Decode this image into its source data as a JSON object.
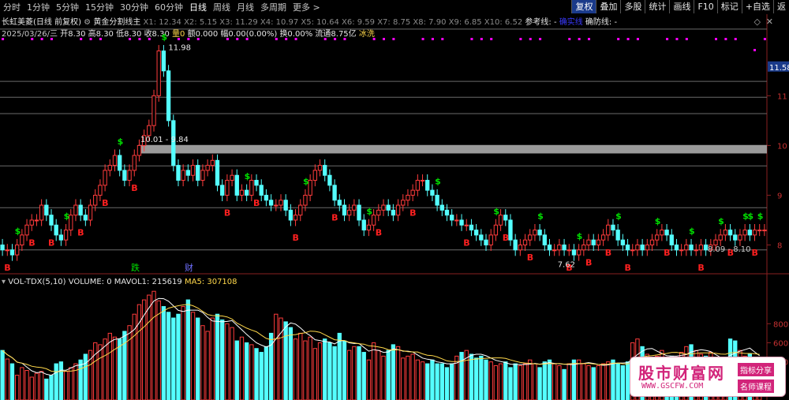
{
  "toolbar": {
    "periods": [
      "分时",
      "1分钟",
      "5分钟",
      "15分钟",
      "30分钟",
      "60分钟",
      "日线",
      "周线",
      "月线",
      "多周期",
      "更多 >"
    ],
    "active_period": "日线",
    "buttons": [
      "复权",
      "叠加",
      "多股",
      "统计",
      "画线",
      "F10",
      "标记",
      "+自选",
      "返"
    ]
  },
  "header": {
    "stock_name": "长虹美菱(日线 前复权)",
    "indicator_name": "黄金分割线主",
    "x_levels": "X1: 12.34  X2: 5.15  X3: 11.29  X4: 10.97  X5: 10.64  X6: 9.59  X7: 8.75  X8: 7.90  X9: 6.85  X10: 6.52",
    "ref_line_label": "参考线: -",
    "mid_label": "确实线",
    "defense_label": "确防线: -",
    "date": "2025/03/26/三",
    "open": "开8.30",
    "high": "高8.30",
    "low": "低8.30",
    "close": "收8.30",
    "volume": "量0",
    "amount": "额0.000",
    "change": "幅0.00(0.00%)",
    "turnover": "换0.00%",
    "float": "流通8.75亿",
    "status": "冰洗"
  },
  "price_axis": {
    "labels": [
      "11",
      "10",
      "9",
      "8"
    ],
    "highlight": "11.58"
  },
  "annotations": {
    "peak": "11.98",
    "gap": "10.01 - 9.84",
    "low": "7.62",
    "right_range": "8.09 - 8.10",
    "event1": "跌",
    "event2": "财"
  },
  "volume_panel": {
    "title": "VOL-TDX(5,10)",
    "volume": "VOLUME: 0",
    "mavol1": "MAVOL1: 215619",
    "ma5": "MA5: 307108",
    "axis_labels": [
      "800",
      "600",
      "400"
    ]
  },
  "watermark": {
    "main": "股市财富网",
    "url": "WWW.GSCFW.COM",
    "tag1": "指标分享",
    "tag2": "名师课程"
  },
  "colors": {
    "up": "#ff3c3c",
    "down": "#54ffff",
    "ma_white": "#ffffff",
    "ma_yellow": "#ffd84a",
    "signal_buy": "#ff2020",
    "signal_sell": "#00e000",
    "marker_magenta": "#ff00ff"
  },
  "chart_data": {
    "type": "candlestick",
    "ylim": [
      7.5,
      12.1
    ],
    "x": [
      1,
      2,
      3,
      4,
      5,
      6,
      7,
      8,
      9,
      10,
      11,
      12,
      13,
      14,
      15,
      16,
      17,
      18,
      19,
      20,
      21,
      22,
      23,
      24,
      25,
      26,
      27,
      28,
      29,
      30,
      31,
      32,
      33,
      34,
      35,
      36,
      37,
      38,
      39,
      40,
      41,
      42,
      43,
      44,
      45,
      46,
      47,
      48,
      49,
      50,
      51,
      52,
      53,
      54,
      55,
      56,
      57,
      58,
      59,
      60,
      61,
      62,
      63,
      64,
      65,
      66,
      67,
      68,
      69,
      70,
      71,
      72,
      73,
      74,
      75,
      76,
      77,
      78,
      79,
      80,
      81,
      82,
      83,
      84,
      85,
      86,
      87,
      88,
      89,
      90,
      91,
      92,
      93,
      94,
      95,
      96,
      97,
      98,
      99,
      100,
      101,
      102,
      103,
      104,
      105,
      106,
      107,
      108,
      109,
      110,
      111,
      112,
      113,
      114,
      115,
      116,
      117,
      118,
      119,
      120,
      121,
      122,
      123,
      124,
      125,
      126,
      127,
      128,
      129,
      130,
      131,
      132,
      133,
      134,
      135,
      136,
      137,
      138,
      139,
      140,
      141,
      142,
      143,
      144,
      145,
      146,
      147,
      148,
      149,
      150,
      151,
      152,
      153,
      154,
      155,
      156,
      157
    ],
    "open": [
      8.0,
      7.9,
      7.9,
      7.8,
      8.0,
      8.2,
      8.4,
      8.5,
      8.5,
      8.8,
      8.6,
      8.4,
      8.2,
      8.1,
      8.3,
      8.6,
      8.8,
      8.6,
      8.5,
      8.8,
      9.0,
      9.2,
      9.5,
      9.6,
      9.8,
      9.5,
      9.3,
      9.5,
      9.8,
      10.0,
      10.2,
      10.4,
      11.0,
      11.9,
      11.5,
      10.5,
      9.6,
      9.3,
      9.5,
      9.4,
      9.6,
      9.3,
      9.5,
      9.6,
      9.7,
      9.2,
      9.0,
      9.3,
      9.4,
      9.0,
      9.1,
      9.0,
      9.3,
      9.2,
      9.0,
      8.9,
      8.8,
      8.8,
      8.9,
      8.7,
      8.5,
      8.6,
      8.8,
      9.0,
      9.3,
      9.5,
      9.6,
      9.4,
      9.2,
      8.9,
      8.8,
      8.6,
      8.7,
      8.8,
      8.5,
      8.3,
      8.4,
      8.6,
      8.7,
      8.8,
      8.7,
      8.6,
      8.8,
      8.9,
      9.0,
      9.1,
      9.3,
      9.3,
      9.1,
      9.0,
      8.8,
      8.7,
      8.6,
      8.5,
      8.5,
      8.4,
      8.4,
      8.3,
      8.2,
      8.1,
      8.0,
      8.2,
      8.4,
      8.6,
      8.5,
      8.1,
      7.9,
      8.0,
      8.1,
      8.2,
      8.3,
      8.2,
      8.0,
      7.9,
      7.9,
      8.0,
      7.9,
      7.9,
      7.8,
      7.9,
      8.0,
      8.1,
      8.0,
      8.1,
      8.2,
      8.4,
      8.3,
      8.1,
      8.0,
      7.9,
      7.9,
      8.0,
      7.9,
      8.0,
      8.1,
      8.2,
      8.3,
      8.2,
      8.0,
      7.9,
      7.9,
      8.0,
      7.9,
      7.9,
      8.0,
      7.9,
      8.0,
      8.1,
      8.2,
      8.3,
      8.2,
      8.1,
      8.2,
      8.3,
      8.2,
      8.3,
      8.3
    ],
    "close": [
      7.9,
      7.9,
      7.8,
      8.0,
      8.2,
      8.4,
      8.5,
      8.5,
      8.8,
      8.6,
      8.4,
      8.2,
      8.1,
      8.3,
      8.6,
      8.8,
      8.6,
      8.5,
      8.8,
      9.0,
      9.2,
      9.5,
      9.6,
      9.8,
      9.5,
      9.3,
      9.5,
      9.8,
      10.0,
      10.2,
      10.4,
      11.0,
      11.9,
      11.5,
      10.5,
      9.6,
      9.3,
      9.5,
      9.4,
      9.6,
      9.3,
      9.5,
      9.6,
      9.7,
      9.2,
      9.0,
      9.3,
      9.4,
      9.0,
      9.1,
      9.0,
      9.3,
      9.2,
      9.0,
      8.9,
      8.8,
      8.8,
      8.9,
      8.7,
      8.5,
      8.6,
      8.8,
      9.0,
      9.3,
      9.5,
      9.6,
      9.4,
      9.2,
      8.9,
      8.8,
      8.6,
      8.7,
      8.8,
      8.5,
      8.3,
      8.4,
      8.6,
      8.7,
      8.8,
      8.7,
      8.6,
      8.8,
      8.9,
      9.0,
      9.1,
      9.3,
      9.3,
      9.1,
      9.0,
      8.8,
      8.7,
      8.6,
      8.5,
      8.5,
      8.4,
      8.4,
      8.3,
      8.2,
      8.1,
      8.0,
      8.2,
      8.4,
      8.6,
      8.5,
      8.1,
      7.9,
      8.0,
      8.1,
      8.2,
      8.3,
      8.2,
      8.0,
      7.9,
      7.9,
      8.0,
      7.9,
      7.9,
      7.8,
      7.9,
      8.0,
      8.1,
      8.0,
      8.1,
      8.2,
      8.4,
      8.3,
      8.1,
      8.0,
      7.9,
      7.9,
      8.0,
      7.9,
      8.0,
      8.1,
      8.2,
      8.3,
      8.2,
      8.0,
      7.9,
      7.9,
      8.0,
      7.9,
      7.9,
      8.0,
      7.9,
      8.0,
      8.1,
      8.2,
      8.3,
      8.2,
      8.1,
      8.2,
      8.3,
      8.2,
      8.3,
      8.3,
      8.3
    ],
    "volume": [
      520,
      430,
      380,
      260,
      340,
      310,
      240,
      280,
      300,
      220,
      260,
      380,
      400,
      300,
      340,
      380,
      420,
      480,
      520,
      600,
      580,
      640,
      700,
      660,
      640,
      720,
      780,
      900,
      1000,
      1050,
      1100,
      1140,
      1040,
      980,
      920,
      860,
      900,
      980,
      1050,
      920,
      860,
      780,
      720,
      860,
      900,
      840,
      800,
      760,
      620,
      660,
      600,
      580,
      540,
      500,
      560,
      700,
      900,
      860,
      820,
      760,
      640,
      700,
      620,
      660,
      540,
      600,
      640,
      600,
      560,
      700,
      620,
      520,
      560,
      560,
      500,
      420,
      600,
      520,
      460,
      520,
      580,
      560,
      440,
      460,
      480,
      420,
      400,
      380,
      420,
      380,
      380,
      340,
      380,
      460,
      500,
      520,
      480,
      440,
      460,
      420,
      400,
      360,
      380,
      400,
      340,
      380,
      360,
      380,
      420,
      380,
      340,
      400,
      420,
      380,
      360,
      320,
      380,
      420,
      420,
      380,
      360,
      340,
      360,
      380,
      400,
      420,
      380,
      360,
      400,
      600,
      640,
      560,
      480,
      420,
      460,
      520,
      440,
      460,
      420,
      500,
      560,
      580,
      520,
      480,
      460,
      500,
      420,
      380,
      400,
      640,
      620,
      520,
      460,
      480,
      440,
      420
    ],
    "h_lines": [
      12.34,
      11.29,
      10.97,
      10.64,
      9.59,
      8.75,
      7.9
    ],
    "buy_signals": [
      3,
      13,
      24,
      33,
      50,
      62,
      75,
      89,
      101,
      110,
      118,
      126,
      134,
      141,
      147,
      152,
      153,
      155
    ],
    "sell_signals": [
      1,
      6,
      10,
      16,
      21,
      27,
      46,
      52,
      60,
      68,
      77,
      84,
      95,
      103,
      108,
      116,
      120,
      124,
      128,
      136,
      143,
      149,
      154
    ]
  }
}
